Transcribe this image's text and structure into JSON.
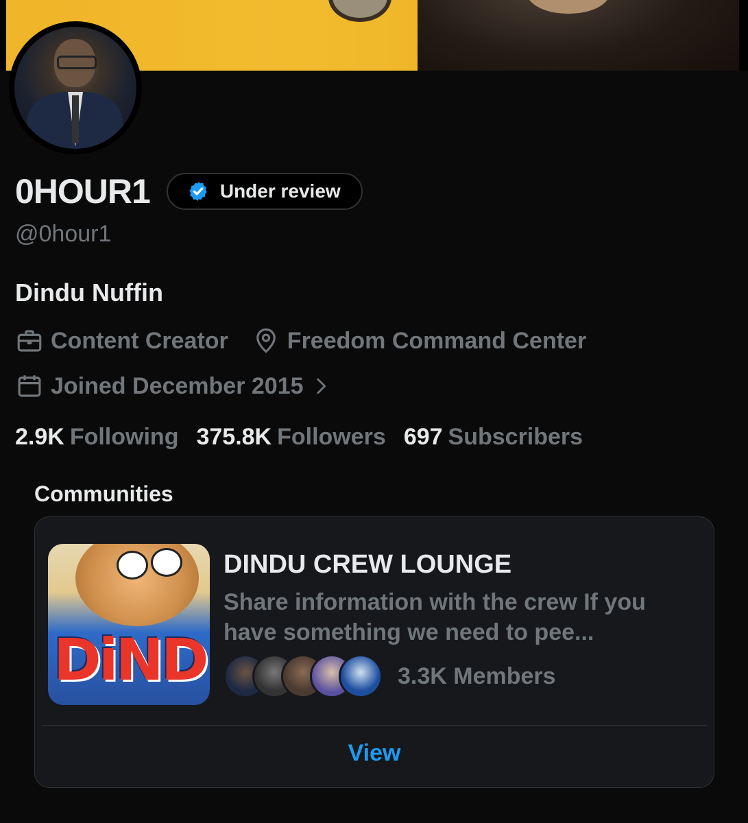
{
  "profile": {
    "display_name": "0HOUR1",
    "verification_badge": "Under review",
    "handle": "@0hour1",
    "bio": "Dindu Nuffin",
    "profession": "Content Creator",
    "location": "Freedom Command Center",
    "joined": "Joined December 2015"
  },
  "stats": {
    "following_count": "2.9K",
    "following_label": "Following",
    "followers_count": "375.8K",
    "followers_label": "Followers",
    "subscribers_count": "697",
    "subscribers_label": "Subscribers"
  },
  "communities": {
    "section_title": "Communities",
    "card": {
      "image_text": "DiND",
      "name": "DINDU CREW LOUNGE",
      "description": "Share information with the crew If you have something we need to pee...",
      "members": "3.3K Members",
      "view_label": "View"
    }
  },
  "icons": {
    "verified": "verified-check-icon",
    "profession": "briefcase-icon",
    "location": "location-pin-icon",
    "joined": "calendar-icon",
    "chevron": "chevron-right-icon"
  },
  "colors": {
    "accent": "#1d9bf0",
    "muted": "#71767b",
    "text": "#e7e9ea",
    "background": "#000000"
  }
}
